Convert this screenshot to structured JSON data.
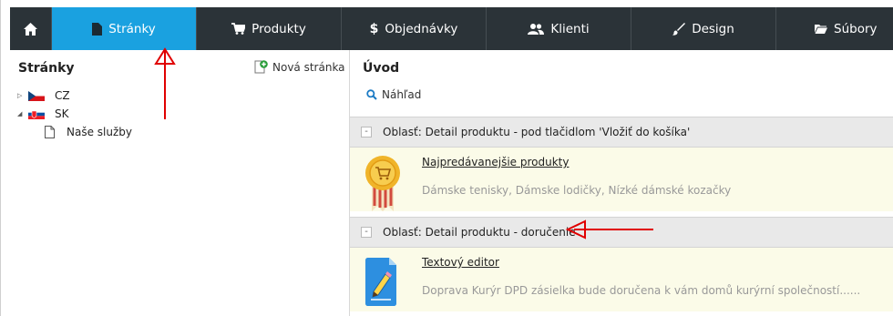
{
  "nav": {
    "items": [
      {
        "label": "Stránky",
        "icon": "page-icon",
        "active": true
      },
      {
        "label": "Produkty",
        "icon": "cart-icon"
      },
      {
        "label": "Objednávky",
        "icon": "dollar-icon"
      },
      {
        "label": "Klienti",
        "icon": "users-icon"
      },
      {
        "label": "Design",
        "icon": "brush-icon"
      },
      {
        "label": "Súbory",
        "icon": "folder-icon"
      }
    ]
  },
  "left": {
    "title": "Stránky",
    "new_page": "Nová stránka",
    "tree": [
      {
        "label": "CZ",
        "flag": "cz"
      },
      {
        "label": "SK",
        "flag": "sk"
      },
      {
        "label": "Naše služby"
      }
    ]
  },
  "right": {
    "title": "Úvod",
    "preview": "Náhľad",
    "areas": [
      {
        "header": "Oblasť: Detail produktu - pod tlačidlom 'Vložiť do košíka'",
        "module_title": "Najpredávanejšie produkty",
        "module_desc": "Dámske tenisky, Dámske lodičky, Nízké dámské kozačky"
      },
      {
        "header": "Oblasť: Detail produktu - doručenie",
        "module_title": "Textový editor",
        "module_desc": "Doprava Kurýr DPD zásielka bude doručena k vám domů kurýrní společností......"
      }
    ]
  },
  "colors": {
    "nav_bg": "#2b3338",
    "nav_active": "#1aa1e0",
    "area_body": "#fbfbe8",
    "annotation_arrow": "#e00000"
  }
}
